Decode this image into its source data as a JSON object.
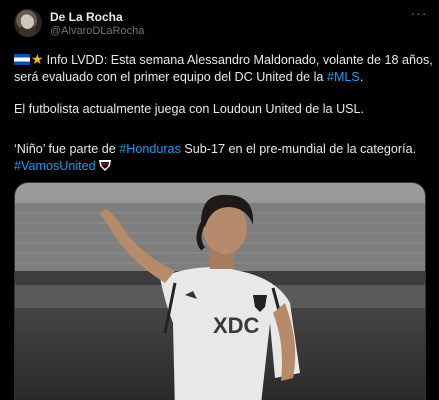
{
  "author": {
    "name": "De La Rocha",
    "handle": "@AlvaroDLaRocha",
    "avatar_icon": "profile-avatar"
  },
  "menu_icon": "more-options-icon",
  "tweet": {
    "p1_text": "Info LVDD: Esta semana Alessandro Maldonado, volante de 18 años, será evaluado con el primer equipo del DC United de la ",
    "p1_hashtag": "#MLS",
    "p1_end": ".",
    "p2_text": "El futbolista actualmente juega con Loudoun United de la USL.",
    "p3_start": "‘Niño’ fue parte de ",
    "p3_hashtag1": "#Honduras",
    "p3_middle": " Sub-17 en el pre-mundial de la categoría.",
    "p3_hashtag2": "#VamosUnited"
  },
  "media": {
    "jersey_brand": "XDC",
    "description_icon": "photo-icon"
  },
  "colors": {
    "background": "#000000",
    "text": "#e7e9ea",
    "muted": "#71767b",
    "link": "#1d9bf0"
  }
}
